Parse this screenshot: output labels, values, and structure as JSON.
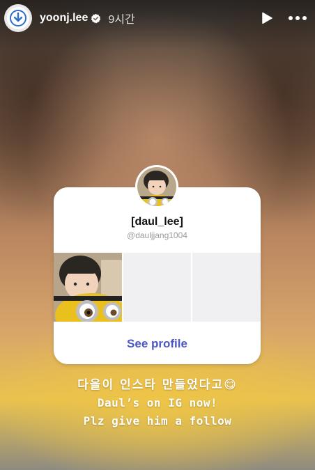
{
  "header": {
    "username": "yoonj.lee",
    "timestamp": "9시간",
    "verified_icon": "verified-badge-icon",
    "play_icon": "play-icon",
    "more_icon": "more-options-icon"
  },
  "card": {
    "display_name": "[daul_lee]",
    "handle": "@dauljjang1004",
    "see_profile_label": "See profile"
  },
  "caption": {
    "line1": "다을이 인스타 만들었다고😋",
    "line2": "Daul’s on IG now!",
    "line3": "Plz give him a follow"
  },
  "colors": {
    "link": "#4a56c8",
    "card_bg": "#ffffff",
    "empty_cell": "#f0f0f2"
  }
}
